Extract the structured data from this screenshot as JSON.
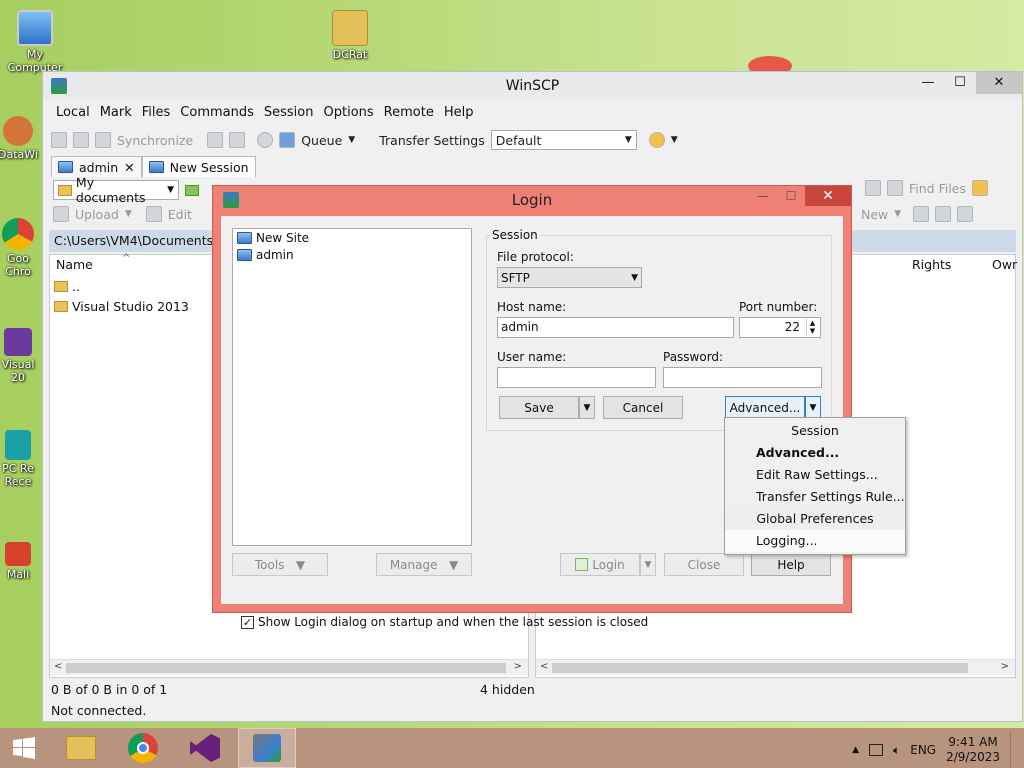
{
  "desktop": {
    "icons": [
      {
        "label": "My Computer"
      },
      {
        "label": "DCRat"
      },
      {
        "label": "DataWi"
      },
      {
        "label": "Goo Chro"
      },
      {
        "label": "Visual 20"
      },
      {
        "label": "PC Re Rece"
      },
      {
        "label": "Mali"
      }
    ]
  },
  "window": {
    "title": "WinSCP",
    "menu": [
      "Local",
      "Mark",
      "Files",
      "Commands",
      "Session",
      "Options",
      "Remote",
      "Help"
    ],
    "toolbar": {
      "synchronize": "Synchronize",
      "queue": "Queue",
      "transfer_settings_label": "Transfer Settings",
      "transfer_settings_value": "Default"
    },
    "tabs": [
      {
        "label": "admin"
      },
      {
        "label": "New Session"
      }
    ],
    "local_toolbar": {
      "location": "My documents",
      "upload": "Upload",
      "edit": "Edit"
    },
    "remote_toolbar": {
      "find_files": "Find Files",
      "new": "New"
    },
    "local_path": "C:\\Users\\VM4\\Documents\\",
    "local_columns": [
      "Name"
    ],
    "remote_columns": [
      "Rights",
      "Owr"
    ],
    "local_files": [
      {
        "name": ".."
      },
      {
        "name": "Visual Studio 2013"
      }
    ],
    "status_left": "0 B of 0 B in 0 of 1",
    "status_hidden": "4 hidden",
    "status_bottom": "Not connected."
  },
  "login": {
    "title": "Login",
    "sites": [
      {
        "label": "New Site"
      },
      {
        "label": "admin"
      }
    ],
    "group_label": "Session",
    "file_protocol_label": "File protocol:",
    "file_protocol_value": "SFTP",
    "host_label": "Host name:",
    "host_value": "admin",
    "port_label": "Port number:",
    "port_value": "22",
    "user_label": "User name:",
    "user_value": "",
    "password_label": "Password:",
    "password_value": "",
    "save_button": "Save",
    "cancel_button": "Cancel",
    "advanced_button": "Advanced...",
    "tools_button": "Tools",
    "manage_button": "Manage",
    "login_button": "Login",
    "close_button": "Close",
    "help_button": "Help",
    "show_checkbox": "Show Login dialog on startup and when the last session is closed",
    "show_checkbox_checked": true
  },
  "advanced_menu": {
    "items": [
      {
        "label": "Session"
      },
      {
        "label": "Advanced..."
      },
      {
        "label": "Edit Raw Settings..."
      },
      {
        "label": "Transfer Settings Rule..."
      },
      {
        "label": "Global Preferences"
      },
      {
        "label": "Logging..."
      }
    ]
  },
  "taskbar": {
    "language": "ENG",
    "time": "9:41 AM",
    "date": "2/9/2023"
  },
  "colors": {
    "dialog_border": "#ef8076",
    "taskbar": "#b8937d",
    "path_bar": "#cdd9e6"
  }
}
